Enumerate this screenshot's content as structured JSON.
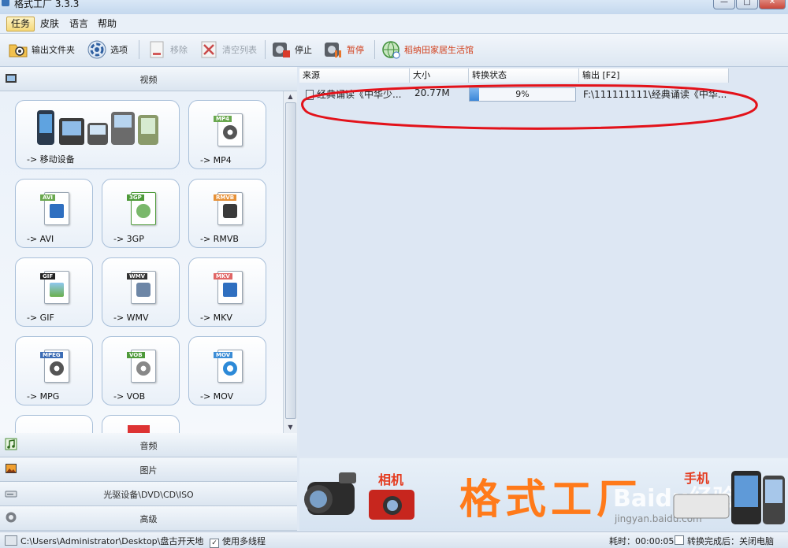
{
  "window": {
    "title": "格式工厂 3.3.3",
    "controls": [
      "—",
      "□",
      "✕"
    ]
  },
  "menu": [
    "任务",
    "皮肤",
    "语言",
    "帮助"
  ],
  "toolbar": {
    "output_folder": "输出文件夹",
    "options": "选项",
    "remove": "移除",
    "clear_list": "清空列表",
    "stop": "停止",
    "pause": "暂停",
    "promo": "稻纳田家居生活馆"
  },
  "sidebar": {
    "video_category": "视频",
    "tiles": [
      {
        "label": "-> 移动设备",
        "icon": "mobile-devices-icon"
      },
      {
        "label": "-> MP4",
        "tag": "MP4",
        "tag_color": "#6aa84f",
        "icon": "mp4-file-icon"
      },
      {
        "label": "-> AVI",
        "tag": "AVI",
        "tag_color": "#6aa84f",
        "icon": "avi-file-icon"
      },
      {
        "label": "-> 3GP",
        "tag": "3GP",
        "tag_color": "#4e9a3a",
        "icon": "3gp-file-icon"
      },
      {
        "label": "-> RMVB",
        "tag": "RMVB",
        "tag_color": "#e69138",
        "icon": "rmvb-file-icon"
      },
      {
        "label": "-> GIF",
        "tag": "GIF",
        "tag_color": "#222222",
        "icon": "gif-file-icon"
      },
      {
        "label": "-> WMV",
        "tag": "WMV",
        "tag_color": "#333333",
        "icon": "wmv-file-icon"
      },
      {
        "label": "-> MKV",
        "tag": "MKV",
        "tag_color": "#e06666",
        "icon": "mkv-file-icon"
      },
      {
        "label": "-> MPG",
        "tag": "MPEG",
        "tag_color": "#3d6db5",
        "icon": "mpg-file-icon"
      },
      {
        "label": "-> VOB",
        "tag": "VOB",
        "tag_color": "#4e9a3a",
        "icon": "vob-file-icon"
      },
      {
        "label": "-> MOV",
        "tag": "MOV",
        "tag_color": "#3c8dd6",
        "icon": "mov-file-icon"
      }
    ],
    "audio_category": "音频",
    "image_category": "图片",
    "rom_category": "光驱设备\\DVD\\CD\\ISO",
    "advanced_category": "高级"
  },
  "task_list": {
    "columns": [
      "来源",
      "大小",
      "转换状态",
      "输出 [F2]"
    ],
    "rows": [
      {
        "source": "经典诵读《中华少...",
        "size": "20.77M",
        "progress": 9,
        "progress_label": "9%",
        "output": "F:\\111111111\\经典诵读《中华..."
      }
    ],
    "annotation_color": "#e3121a"
  },
  "banner": {
    "camera_label": "相机",
    "brand_text": "格式工厂",
    "phone_label": "手机",
    "watermark": "Baidu经验",
    "watermark_url": "jingyan.baidu.com"
  },
  "statusbar": {
    "path": "C:\\Users\\Administrator\\Desktop\\盘古开天地",
    "multithread_label": "使用多线程",
    "multithread_checked": true,
    "elapsed": "耗时：00:00:05",
    "after_done": "转换完成后：关闭电脑"
  }
}
